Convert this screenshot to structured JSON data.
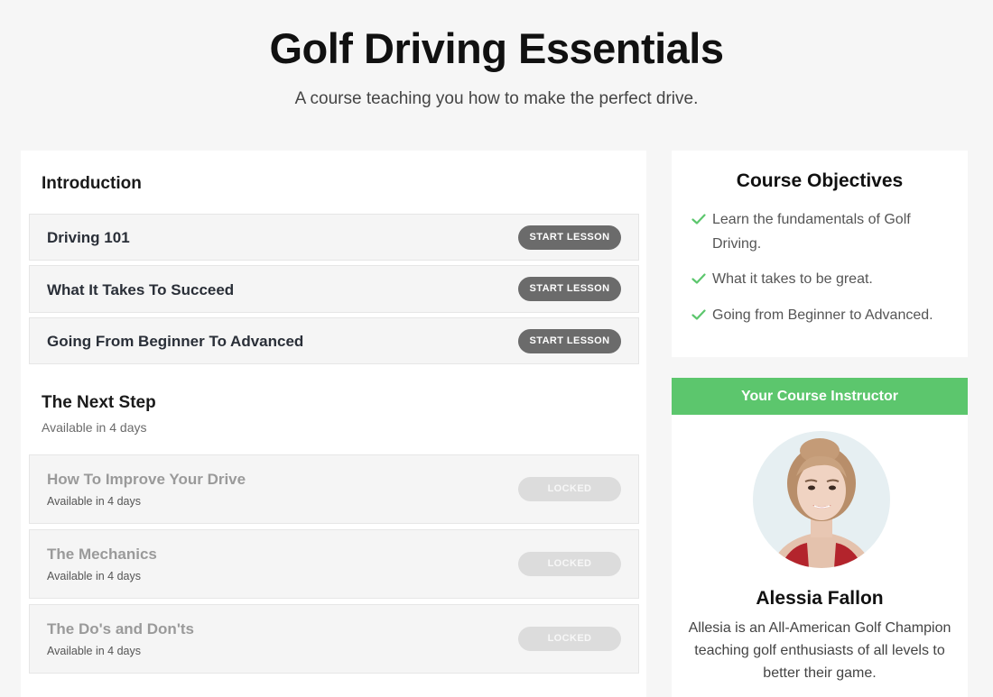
{
  "header": {
    "title": "Golf Driving Essentials",
    "subtitle": "A course teaching you how to make the perfect drive."
  },
  "sections": [
    {
      "title": "Introduction",
      "lessons": [
        {
          "title": "Driving 101",
          "button": "START LESSON"
        },
        {
          "title": "What It Takes To Succeed",
          "button": "START LESSON"
        },
        {
          "title": "Going From Beginner To Advanced",
          "button": "START LESSON"
        }
      ]
    },
    {
      "title": "The Next Step",
      "availability": "Available in 4 days",
      "lessons": [
        {
          "title": "How To Improve Your Drive",
          "availability": "Available in 4 days",
          "button": "LOCKED"
        },
        {
          "title": "The Mechanics",
          "availability": "Available in 4 days",
          "button": "LOCKED"
        },
        {
          "title": "The Do's and Don'ts",
          "availability": "Available in 4 days",
          "button": "LOCKED"
        }
      ]
    }
  ],
  "objectives": {
    "title": "Course Objectives",
    "items": [
      "Learn the fundamentals of Golf Driving.",
      "What it takes to be great.",
      "Going from Beginner to Advanced."
    ],
    "check_icon": "check-icon",
    "check_color": "#5cc66d"
  },
  "instructor": {
    "banner": "Your Course Instructor",
    "name": "Alessia Fallon",
    "bio": "Allesia is an All-American Golf Champion teaching golf enthusiasts of all levels to better their game.",
    "banner_color": "#5cc66d"
  }
}
